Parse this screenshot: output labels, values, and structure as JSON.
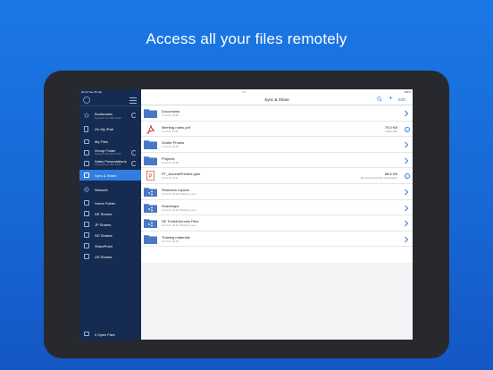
{
  "headline": "Access all your files remotely",
  "status_bar": {
    "time": "10:14",
    "date": "Tue 26 Jan",
    "battery": "100%"
  },
  "sidebar": {
    "items": [
      {
        "label": "Bookmarks",
        "sub": "Synced 8 min 2021 19:34",
        "icon": "star-icon"
      },
      {
        "label": "On My iPad",
        "icon": "tablet-icon"
      },
      {
        "label": "My Files",
        "icon": "folder-icon"
      },
      {
        "label": "Group Folder",
        "sub": "Synced 8 min 2021 19:34",
        "icon": "shared-folder-icon"
      },
      {
        "label": "Sales Presentations",
        "sub": "Synced 8 min 2021 19:34",
        "icon": "shared-folder-icon"
      },
      {
        "label": "Sync & Share",
        "icon": "sync-share-icon"
      },
      {
        "label": "Network",
        "icon": "globe-icon"
      },
      {
        "label": "Home Folder",
        "icon": "network-folder-icon"
      },
      {
        "label": "DE Shares",
        "icon": "network-folder-icon"
      },
      {
        "label": "JP Shares",
        "icon": "network-folder-icon"
      },
      {
        "label": "SG Shares",
        "icon": "network-folder-icon"
      },
      {
        "label": "SharePoint",
        "icon": "network-folder-icon"
      },
      {
        "label": "US Shares",
        "icon": "network-folder-icon"
      }
    ],
    "footer": "0 Open Files",
    "active": "Sync & Share"
  },
  "navbar": {
    "title": "Sync & Share",
    "edit_label": "Edit"
  },
  "files": [
    {
      "name": "Documents",
      "meta": "14.12.21, 20:08",
      "type": "folder"
    },
    {
      "name": "Meeting notes.pdf",
      "meta": "14.12.21, 18:51",
      "size": "79,5 KB",
      "kind": "Adobe PDF",
      "type": "pdf"
    },
    {
      "name": "Onsite Photos",
      "meta": "14.12.21, 20:06",
      "type": "folder"
    },
    {
      "name": "Projects",
      "meta": "14.12.21, 20:08",
      "type": "folder"
    },
    {
      "name": "PT_AcronisPresent.pptx",
      "meta": "14.12.21, 19:11",
      "size": "58,6 KB",
      "kind": "Microsoft PowerPoint Presentation",
      "type": "pptx"
    },
    {
      "name": "Research reports",
      "meta": "14.12.21, 20:08 (Shared by you)",
      "type": "shared-folder"
    },
    {
      "name": "Roadmaps",
      "meta": "14.12.21, 20:11 (Shared by you)",
      "type": "shared-folder"
    },
    {
      "name": "SE Toolkit Acronis Files",
      "meta": "14.12.21, 20:11 (Shared by you)",
      "type": "shared-folder"
    },
    {
      "name": "Training materials",
      "meta": "14.12.21, 20:18",
      "type": "folder"
    }
  ],
  "colors": {
    "accent": "#2f7ee0",
    "sidebar": "#152b52",
    "folder": "#4a78c4",
    "background": "#1a78e6"
  }
}
